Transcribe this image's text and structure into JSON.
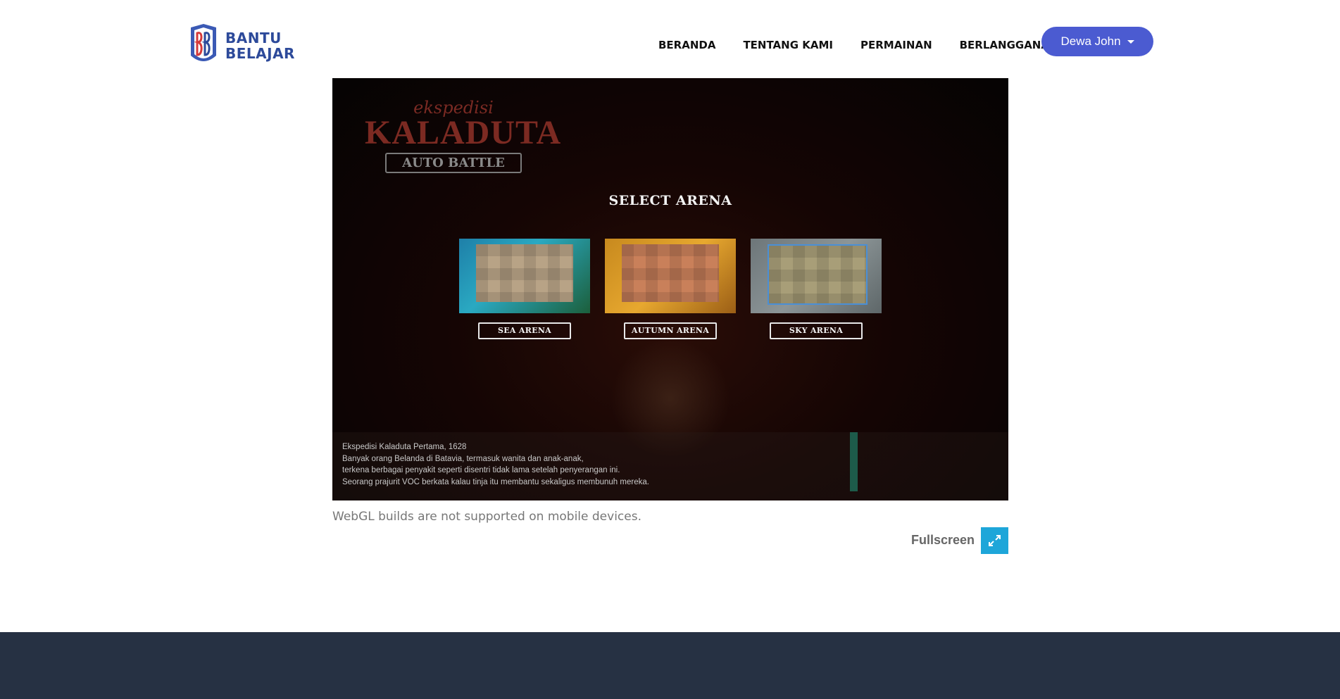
{
  "header": {
    "logo_line1": "BANTU",
    "logo_line2": "BELAJAR",
    "nav": [
      "BERANDA",
      "TENTANG KAMI",
      "PERMAINAN",
      "BERLANGGANAN"
    ],
    "user": "Dewa John"
  },
  "game": {
    "logo_sub": "ekspedisi",
    "logo_main": "KALADUTA",
    "logo_mode": "AUTO BATTLE",
    "select_title": "SELECT ARENA",
    "arenas": [
      "SEA ARENA",
      "AUTUMN ARENA",
      "SKY ARENA"
    ],
    "story": [
      "Ekspedisi Kaladuta Pertama, 1628",
      "Banyak orang Belanda di Batavia, termasuk wanita dan anak-anak,",
      "terkena berbagai penyakit seperti disentri tidak lama setelah penyerangan ini.",
      "Seorang prajurit VOC berkata kalau tinja itu membantu sekaligus membunuh mereka."
    ]
  },
  "notice": "WebGL builds are not supported on mobile devices.",
  "fullscreen_label": "Fullscreen",
  "colors": {
    "accent": "#4b5bd1",
    "fullscreen": "#1ea6d9",
    "footer": "#263143",
    "logo": "#2d4a9a"
  }
}
